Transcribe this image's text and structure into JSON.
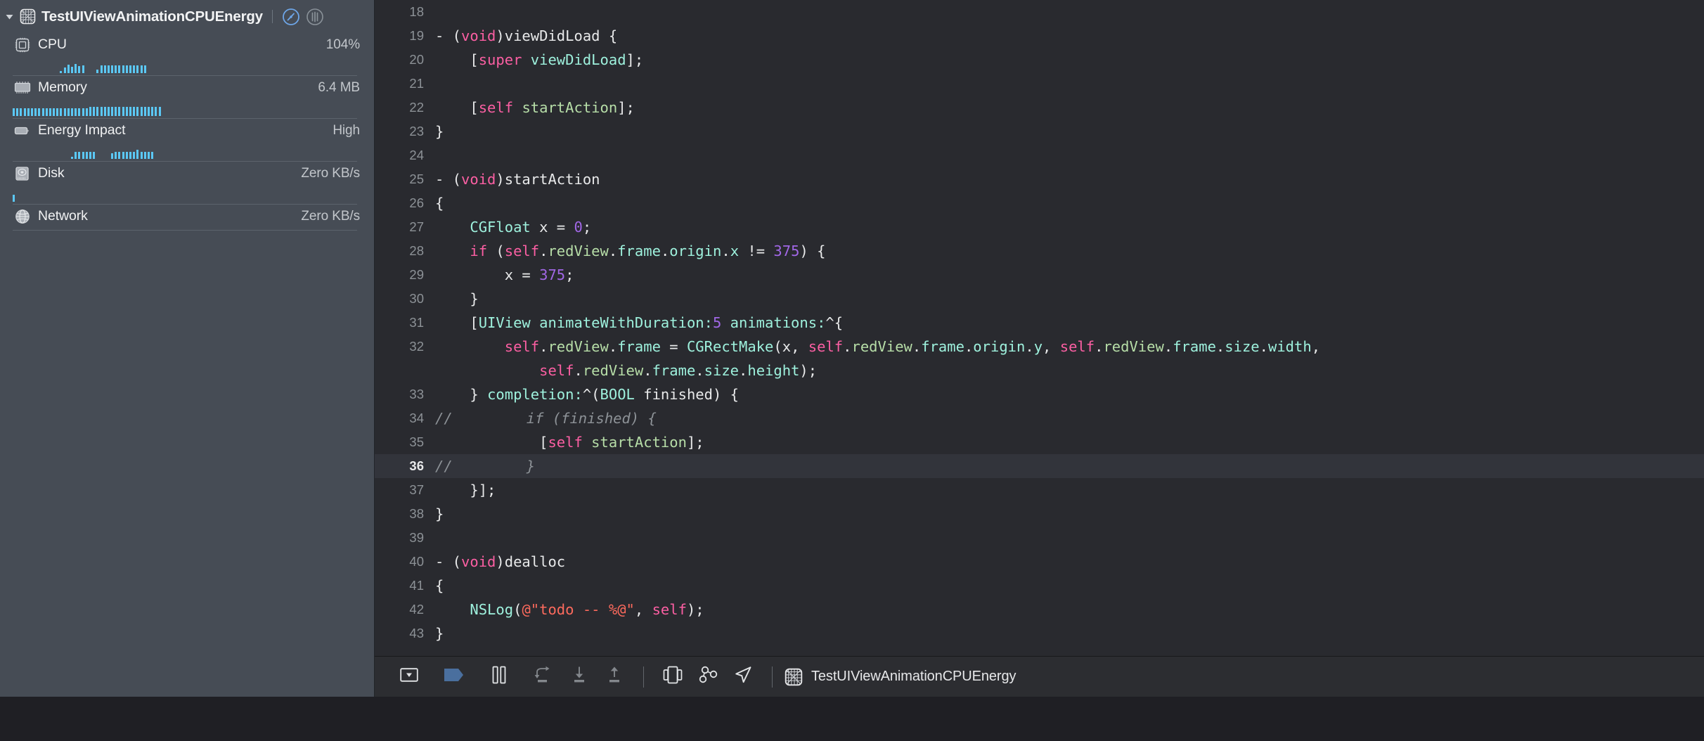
{
  "navigator": {
    "process_title": "TestUIViewAnimationCPUEnergy",
    "app_icon_name": "app-bundle-icon",
    "disclosure_icon_name": "disclosure-triangle-open-icon",
    "gauge_buttons": [
      {
        "name": "gauges-view-button",
        "icon": "gauge-icon",
        "active": true
      },
      {
        "name": "reports-view-button",
        "icon": "bars-icon",
        "active": false
      }
    ],
    "metrics": [
      {
        "label": "CPU",
        "value": "104%",
        "icon": "cpu-chip-icon",
        "spark": [
          0,
          0,
          0,
          0,
          0,
          0,
          0,
          0,
          0,
          0,
          0,
          0,
          0,
          3,
          8,
          12,
          9,
          13,
          10,
          11,
          0,
          0,
          0,
          5,
          11,
          11,
          11,
          11,
          11,
          11,
          11,
          11,
          11,
          11,
          11,
          11,
          11
        ],
        "has_spark": true
      },
      {
        "label": "Memory",
        "value": "6.4 MB",
        "icon": "memory-chip-icon",
        "spark": [
          11,
          11,
          11,
          11,
          11,
          11,
          11,
          11,
          11,
          11,
          11,
          11,
          11,
          11,
          11,
          11,
          11,
          11,
          11,
          11,
          11,
          13,
          13,
          13,
          13,
          13,
          13,
          13,
          13,
          13,
          13,
          13,
          13,
          13,
          13,
          13,
          13,
          13,
          13,
          13,
          13
        ],
        "has_spark": true,
        "spark_from_left": true
      },
      {
        "label": "Energy Impact",
        "value": "High",
        "icon": "battery-icon",
        "spark": [
          0,
          0,
          0,
          0,
          0,
          0,
          0,
          0,
          0,
          0,
          0,
          0,
          0,
          0,
          0,
          0,
          3,
          10,
          10,
          10,
          10,
          10,
          10,
          0,
          0,
          0,
          0,
          8,
          10,
          10,
          10,
          10,
          10,
          10,
          13,
          10,
          10,
          10,
          10
        ],
        "has_spark": true
      },
      {
        "label": "Disk",
        "value": "Zero KB/s",
        "icon": "disk-drive-icon",
        "spark": [
          10
        ],
        "has_spark": true,
        "spark_from_left": true
      },
      {
        "label": "Network",
        "value": "Zero KB/s",
        "icon": "network-globe-icon",
        "spark": [],
        "has_spark": false
      }
    ]
  },
  "editor": {
    "lines": [
      {
        "n": "18",
        "comment_mark": "",
        "tokens": []
      },
      {
        "n": "19",
        "comment_mark": "",
        "tokens": [
          {
            "t": "- (",
            "c": "plain"
          },
          {
            "t": "void",
            "c": "k"
          },
          {
            "t": ")viewDidLoad {",
            "c": "plain"
          }
        ]
      },
      {
        "n": "20",
        "comment_mark": "",
        "tokens": [
          {
            "t": "    [",
            "c": "plain"
          },
          {
            "t": "super",
            "c": "k"
          },
          {
            "t": " ",
            "c": "plain"
          },
          {
            "t": "viewDidLoad",
            "c": "cls"
          },
          {
            "t": "];",
            "c": "plain"
          }
        ]
      },
      {
        "n": "21",
        "comment_mark": "",
        "tokens": []
      },
      {
        "n": "22",
        "comment_mark": "",
        "tokens": [
          {
            "t": "    [",
            "c": "plain"
          },
          {
            "t": "self",
            "c": "k"
          },
          {
            "t": " ",
            "c": "plain"
          },
          {
            "t": "startAction",
            "c": "prop"
          },
          {
            "t": "];",
            "c": "plain"
          }
        ]
      },
      {
        "n": "23",
        "comment_mark": "",
        "tokens": [
          {
            "t": "}",
            "c": "plain"
          }
        ]
      },
      {
        "n": "24",
        "comment_mark": "",
        "tokens": []
      },
      {
        "n": "25",
        "comment_mark": "",
        "tokens": [
          {
            "t": "- (",
            "c": "plain"
          },
          {
            "t": "void",
            "c": "k"
          },
          {
            "t": ")startAction",
            "c": "plain"
          }
        ]
      },
      {
        "n": "26",
        "comment_mark": "",
        "tokens": [
          {
            "t": "{",
            "c": "plain"
          }
        ]
      },
      {
        "n": "27",
        "comment_mark": "",
        "tokens": [
          {
            "t": "    ",
            "c": "plain"
          },
          {
            "t": "CGFloat",
            "c": "cls"
          },
          {
            "t": " x = ",
            "c": "plain"
          },
          {
            "t": "0",
            "c": "num"
          },
          {
            "t": ";",
            "c": "plain"
          }
        ]
      },
      {
        "n": "28",
        "comment_mark": "",
        "tokens": [
          {
            "t": "    ",
            "c": "plain"
          },
          {
            "t": "if",
            "c": "k"
          },
          {
            "t": " (",
            "c": "plain"
          },
          {
            "t": "self",
            "c": "k"
          },
          {
            "t": ".",
            "c": "plain"
          },
          {
            "t": "redView",
            "c": "prop"
          },
          {
            "t": ".",
            "c": "plain"
          },
          {
            "t": "frame",
            "c": "cls"
          },
          {
            "t": ".",
            "c": "plain"
          },
          {
            "t": "origin",
            "c": "cls"
          },
          {
            "t": ".",
            "c": "plain"
          },
          {
            "t": "x",
            "c": "cls"
          },
          {
            "t": " != ",
            "c": "plain"
          },
          {
            "t": "375",
            "c": "num"
          },
          {
            "t": ") {",
            "c": "plain"
          }
        ]
      },
      {
        "n": "29",
        "comment_mark": "",
        "tokens": [
          {
            "t": "        x = ",
            "c": "plain"
          },
          {
            "t": "375",
            "c": "num"
          },
          {
            "t": ";",
            "c": "plain"
          }
        ]
      },
      {
        "n": "30",
        "comment_mark": "",
        "tokens": [
          {
            "t": "    }",
            "c": "plain"
          }
        ]
      },
      {
        "n": "31",
        "comment_mark": "",
        "tokens": [
          {
            "t": "    [",
            "c": "plain"
          },
          {
            "t": "UIView",
            "c": "cls"
          },
          {
            "t": " ",
            "c": "plain"
          },
          {
            "t": "animateWithDuration:",
            "c": "cls"
          },
          {
            "t": "5",
            "c": "num"
          },
          {
            "t": " ",
            "c": "plain"
          },
          {
            "t": "animations:",
            "c": "cls"
          },
          {
            "t": "^{",
            "c": "plain"
          }
        ]
      },
      {
        "n": "32",
        "comment_mark": "",
        "tokens": [
          {
            "t": "        ",
            "c": "plain"
          },
          {
            "t": "self",
            "c": "k"
          },
          {
            "t": ".",
            "c": "plain"
          },
          {
            "t": "redView",
            "c": "prop"
          },
          {
            "t": ".",
            "c": "plain"
          },
          {
            "t": "frame",
            "c": "cls"
          },
          {
            "t": " = ",
            "c": "plain"
          },
          {
            "t": "CGRectMake",
            "c": "cls"
          },
          {
            "t": "(x, ",
            "c": "plain"
          },
          {
            "t": "self",
            "c": "k"
          },
          {
            "t": ".",
            "c": "plain"
          },
          {
            "t": "redView",
            "c": "prop"
          },
          {
            "t": ".",
            "c": "plain"
          },
          {
            "t": "frame",
            "c": "cls"
          },
          {
            "t": ".",
            "c": "plain"
          },
          {
            "t": "origin",
            "c": "cls"
          },
          {
            "t": ".",
            "c": "plain"
          },
          {
            "t": "y",
            "c": "cls"
          },
          {
            "t": ", ",
            "c": "plain"
          },
          {
            "t": "self",
            "c": "k"
          },
          {
            "t": ".",
            "c": "plain"
          },
          {
            "t": "redView",
            "c": "prop"
          },
          {
            "t": ".",
            "c": "plain"
          },
          {
            "t": "frame",
            "c": "cls"
          },
          {
            "t": ".",
            "c": "plain"
          },
          {
            "t": "size",
            "c": "cls"
          },
          {
            "t": ".",
            "c": "plain"
          },
          {
            "t": "width",
            "c": "cls"
          },
          {
            "t": ",",
            "c": "plain"
          }
        ]
      },
      {
        "n": "",
        "comment_mark": "",
        "wrap": true,
        "tokens": [
          {
            "t": "            ",
            "c": "plain"
          },
          {
            "t": "self",
            "c": "k"
          },
          {
            "t": ".",
            "c": "plain"
          },
          {
            "t": "redView",
            "c": "prop"
          },
          {
            "t": ".",
            "c": "plain"
          },
          {
            "t": "frame",
            "c": "cls"
          },
          {
            "t": ".",
            "c": "plain"
          },
          {
            "t": "size",
            "c": "cls"
          },
          {
            "t": ".",
            "c": "plain"
          },
          {
            "t": "height",
            "c": "cls"
          },
          {
            "t": ");",
            "c": "plain"
          }
        ]
      },
      {
        "n": "33",
        "comment_mark": "",
        "tokens": [
          {
            "t": "    } ",
            "c": "plain"
          },
          {
            "t": "completion:",
            "c": "cls"
          },
          {
            "t": "^(",
            "c": "plain"
          },
          {
            "t": "BOOL",
            "c": "cls"
          },
          {
            "t": " finished) {",
            "c": "plain"
          }
        ]
      },
      {
        "n": "34",
        "comment_mark": "//",
        "tokens": [
          {
            "t": "        if (finished) {",
            "c": "cmt"
          }
        ]
      },
      {
        "n": "35",
        "comment_mark": "",
        "tokens": [
          {
            "t": "            [",
            "c": "plain"
          },
          {
            "t": "self",
            "c": "k"
          },
          {
            "t": " ",
            "c": "plain"
          },
          {
            "t": "startAction",
            "c": "prop"
          },
          {
            "t": "];",
            "c": "plain"
          }
        ]
      },
      {
        "n": "36",
        "comment_mark": "//",
        "current": true,
        "tokens": [
          {
            "t": "        }",
            "c": "cmt"
          }
        ]
      },
      {
        "n": "37",
        "comment_mark": "",
        "tokens": [
          {
            "t": "    }];",
            "c": "plain"
          }
        ]
      },
      {
        "n": "38",
        "comment_mark": "",
        "tokens": [
          {
            "t": "}",
            "c": "plain"
          }
        ]
      },
      {
        "n": "39",
        "comment_mark": "",
        "tokens": []
      },
      {
        "n": "40",
        "comment_mark": "",
        "tokens": [
          {
            "t": "- (",
            "c": "plain"
          },
          {
            "t": "void",
            "c": "k"
          },
          {
            "t": ")dealloc",
            "c": "plain"
          }
        ]
      },
      {
        "n": "41",
        "comment_mark": "",
        "tokens": [
          {
            "t": "{",
            "c": "plain"
          }
        ]
      },
      {
        "n": "42",
        "comment_mark": "",
        "tokens": [
          {
            "t": "    ",
            "c": "plain"
          },
          {
            "t": "NSLog",
            "c": "cls"
          },
          {
            "t": "(",
            "c": "plain"
          },
          {
            "t": "@\"todo -- %@\"",
            "c": "str"
          },
          {
            "t": ", ",
            "c": "plain"
          },
          {
            "t": "self",
            "c": "k"
          },
          {
            "t": ");",
            "c": "plain"
          }
        ]
      },
      {
        "n": "43",
        "comment_mark": "",
        "tokens": [
          {
            "t": "}",
            "c": "plain"
          }
        ]
      }
    ]
  },
  "debug_bar": {
    "buttons": [
      {
        "name": "hide-debug-area-button",
        "icon": "hide-debug-area-icon",
        "state": "enabled"
      },
      {
        "name": "activate-breakpoints-button",
        "icon": "breakpoint-flag-icon",
        "state": "active"
      },
      {
        "name": "pause-button",
        "icon": "pause-icon",
        "state": "enabled"
      },
      {
        "name": "step-over-button",
        "icon": "step-over-icon",
        "state": "disabled"
      },
      {
        "name": "step-into-button",
        "icon": "step-into-icon",
        "state": "disabled"
      },
      {
        "name": "step-out-button",
        "icon": "step-out-icon",
        "state": "disabled"
      },
      {
        "name": "debug-view-hierarchy-button",
        "icon": "view-hierarchy-icon",
        "state": "enabled"
      },
      {
        "name": "debug-memory-graph-button",
        "icon": "memory-graph-icon",
        "state": "enabled"
      },
      {
        "name": "simulate-location-button",
        "icon": "location-arrow-icon",
        "state": "enabled"
      }
    ],
    "process_name": "TestUIViewAnimationCPUEnergy",
    "process_icon": "app-bundle-icon"
  },
  "colors": {
    "navigator_bg": "#464c55",
    "editor_bg": "#292a2f",
    "current_line_bg": "#32343b",
    "debug_bar_bg": "#2c2d31",
    "spark_blue": "#5bc8f5",
    "breakpoint_blue": "#4a6f9e",
    "keyword_pink": "#fc5fa3",
    "type_teal": "#9ef1dd",
    "property_green": "#b7dea8",
    "number_purple": "#a167e6",
    "string_red": "#fc6a5d",
    "comment_gray": "#8d9297"
  }
}
